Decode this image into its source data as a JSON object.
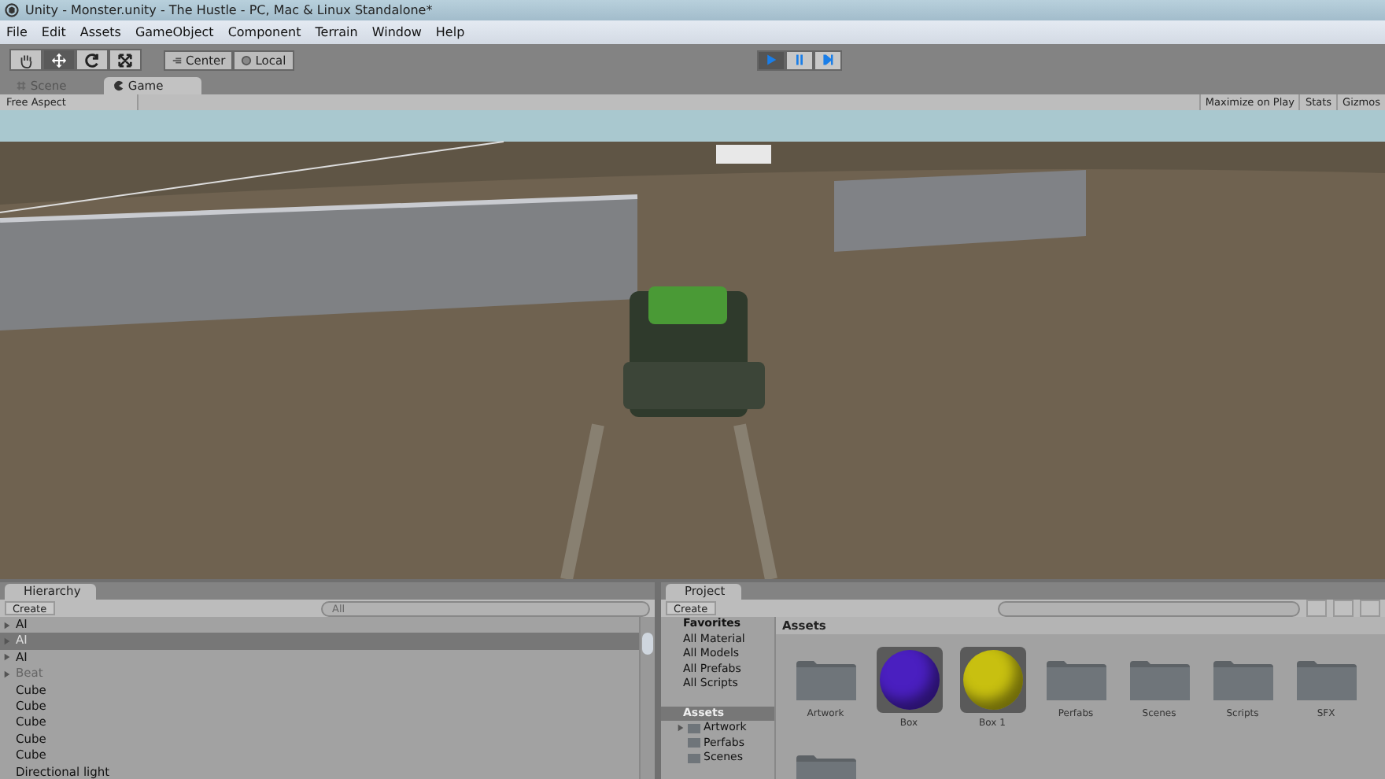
{
  "window": {
    "title": "Unity - Monster.unity - The Hustle - PC, Mac & Linux Standalone*"
  },
  "menu": [
    "File",
    "Edit",
    "Assets",
    "GameObject",
    "Component",
    "Terrain",
    "Window",
    "Help"
  ],
  "tools": [
    {
      "kind": "hand",
      "selected": false
    },
    {
      "kind": "move",
      "selected": true
    },
    {
      "kind": "rotate",
      "selected": false
    },
    {
      "kind": "scale",
      "selected": false
    }
  ],
  "pivot_buttons": [
    {
      "kind": "center",
      "label": "Center"
    },
    {
      "kind": "local",
      "label": "Local"
    }
  ],
  "play_controls": [
    {
      "kind": "play",
      "selected": true
    },
    {
      "kind": "pause",
      "selected": false
    },
    {
      "kind": "step",
      "selected": false
    }
  ],
  "view_tabs": [
    {
      "kind": "scene",
      "label": "Scene",
      "selected": false
    },
    {
      "kind": "game",
      "label": "Game",
      "selected": true
    }
  ],
  "game_bar": {
    "aspect": "Free Aspect",
    "buttons": [
      "Maximize on Play",
      "Stats",
      "Gizmos"
    ]
  },
  "hierarchy": {
    "tab": "Hierarchy",
    "create": "Create",
    "search_placeholder": "All",
    "items": [
      {
        "label": "AI",
        "expandable": true,
        "selected": false,
        "disabled": false
      },
      {
        "label": "AI",
        "expandable": true,
        "selected": true,
        "disabled": false
      },
      {
        "label": "AI",
        "expandable": true,
        "selected": false,
        "disabled": false
      },
      {
        "label": "Beat",
        "expandable": true,
        "selected": false,
        "disabled": true
      },
      {
        "label": "Cube",
        "expandable": false,
        "selected": false,
        "disabled": false
      },
      {
        "label": "Cube",
        "expandable": false,
        "selected": false,
        "disabled": false
      },
      {
        "label": "Cube",
        "expandable": false,
        "selected": false,
        "disabled": false
      },
      {
        "label": "Cube",
        "expandable": false,
        "selected": false,
        "disabled": false
      },
      {
        "label": "Cube",
        "expandable": false,
        "selected": false,
        "disabled": false
      },
      {
        "label": "Directional light",
        "expandable": false,
        "selected": false,
        "disabled": false
      }
    ]
  },
  "project": {
    "tab": "Project",
    "create": "Create",
    "breadcrumb": "Assets",
    "favorites": {
      "label": "Favorites",
      "items": [
        "All Material",
        "All Models",
        "All Prefabs",
        "All Scripts"
      ]
    },
    "assets_tree": {
      "label": "Assets",
      "selected": true,
      "children": [
        {
          "label": "Artwork",
          "expandable": true
        },
        {
          "label": "Perfabs",
          "expandable": false
        },
        {
          "label": "Scenes",
          "expandable": false
        }
      ]
    },
    "assets": [
      {
        "kind": "folder",
        "label": "Artwork"
      },
      {
        "kind": "material",
        "label": "Box",
        "color": "#4a1fc0"
      },
      {
        "kind": "material",
        "label": "Box 1",
        "color": "#c8c010"
      },
      {
        "kind": "folder",
        "label": "Perfabs"
      },
      {
        "kind": "folder",
        "label": "Scenes"
      },
      {
        "kind": "folder",
        "label": "Scripts"
      },
      {
        "kind": "folder",
        "label": "SFX"
      },
      {
        "kind": "folder"
      }
    ]
  }
}
